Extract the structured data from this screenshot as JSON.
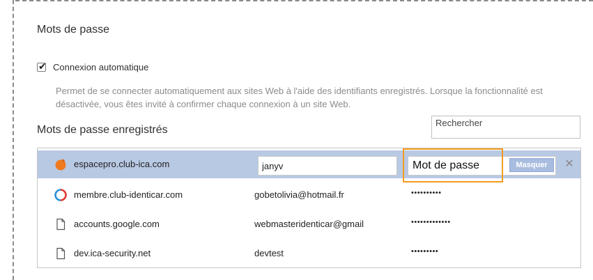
{
  "section": {
    "title": "Mots de passe"
  },
  "auto_login": {
    "label": "Connexion automatique",
    "checked": true,
    "description": "Permet de se connecter automatiquement aux sites Web à l'aide des identifiants enregistrés. Lorsque la fonctionnalité est désactivée, vous êtes invité à confirmer chaque connexion à un site Web."
  },
  "saved": {
    "title": "Mots de passe enregistrés",
    "search_placeholder": "Rechercher",
    "hide_label": "Masquer",
    "delete_glyph": "✕",
    "rows": [
      {
        "site": "espacepro.club-ica.com",
        "username": "janyv",
        "password": "Mot de passe",
        "icon": "orange-logo-icon",
        "selected": true
      },
      {
        "site": "membre.club-identicar.com",
        "username": "gobetolivia@hotmail.fr",
        "password": "••••••••••",
        "icon": "club-identicar-logo-icon"
      },
      {
        "site": "accounts.google.com",
        "username": "webmasteridenticar@gmail",
        "password": "•••••••••••••",
        "icon": "page-icon"
      },
      {
        "site": "dev.ica-security.net",
        "username": "devtest",
        "password": "•••••••••",
        "icon": "page-icon"
      }
    ]
  },
  "colors": {
    "selected_row": "#b8c9e4",
    "highlight_border": "#f39c1e",
    "hide_button": "#a9bde0"
  }
}
